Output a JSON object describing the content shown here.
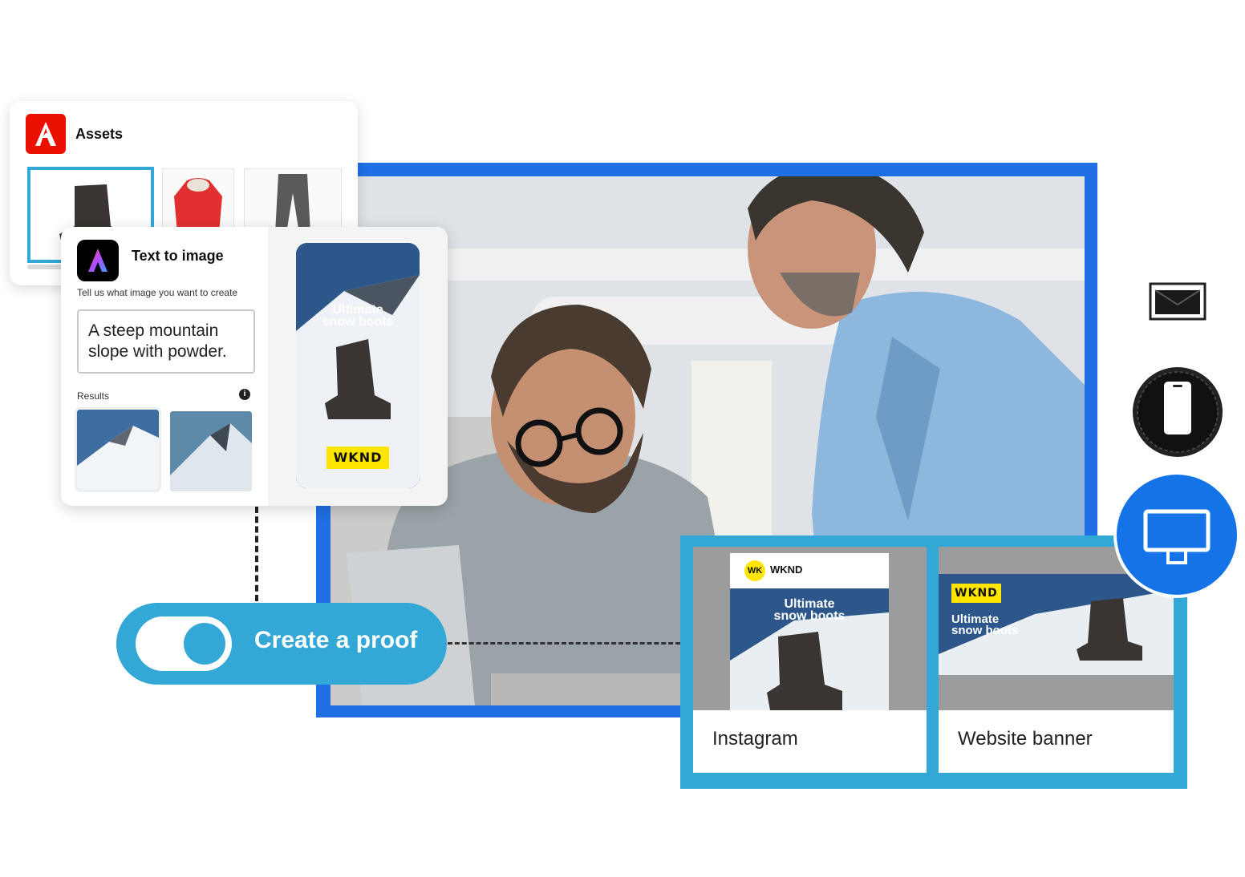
{
  "assets_card": {
    "title": "Assets",
    "items": [
      "snow-boot",
      "red-jacket",
      "gray-pants"
    ]
  },
  "text_to_image": {
    "title": "Text to image",
    "instruction": "Tell us what image you want to create",
    "prompt_value": "A steep mountain slope with powder.",
    "results_label": "Results",
    "preview": {
      "headline_line1": "Ultimate",
      "headline_line2": "snow boots",
      "brand_tag": "WKND"
    }
  },
  "toggle": {
    "label": "Create a proof",
    "state": "on"
  },
  "proofs": [
    {
      "name": "Instagram",
      "brand_badge": "WK",
      "brand_name": "WKND",
      "headline_line1": "Ultimate",
      "headline_line2": "snow boots"
    },
    {
      "name": "Website banner",
      "brand_tag": "WKND",
      "headline_line1": "Ultimate",
      "headline_line2": "snow boots"
    }
  ],
  "devices": [
    "email-icon",
    "mobile-icon",
    "desktop-icon"
  ],
  "colors": {
    "frame_blue": "#1f6fe5",
    "accent_cyan": "#33a7d6",
    "adobe_red": "#eb1000",
    "wknd_yellow": "#ffe600",
    "desktop_badge": "#1473e6"
  }
}
